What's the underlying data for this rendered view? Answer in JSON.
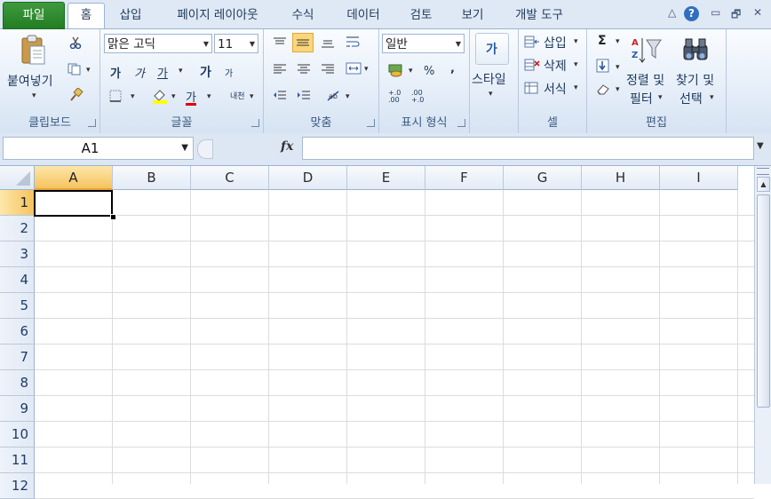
{
  "tabs": {
    "file": "파일",
    "home": "홈",
    "insert": "삽입",
    "page_layout": "페이지 레이아웃",
    "formulas": "수식",
    "data": "데이터",
    "review": "검토",
    "view": "보기",
    "developer": "개발 도구"
  },
  "window_controls": {
    "minimize_ribbon": "△",
    "help": "?",
    "minimize": "▭",
    "restore": "🗗",
    "close": "✕"
  },
  "clipboard": {
    "paste": "붙여넣기",
    "label": "클립보드"
  },
  "font": {
    "name": "맑은 고딕",
    "size": "11",
    "bold": "가",
    "italic": "가",
    "underline": "가",
    "grow": "가",
    "shrink": "가",
    "font_color_glyph": "가",
    "phonetic": "내천",
    "label": "글꼴"
  },
  "alignment": {
    "label": "맞춤"
  },
  "number": {
    "format": "일반",
    "percent": "%",
    "comma": ",",
    "inc_dec": "+.0 .00",
    "dec_dec": ".00 +.0",
    "label": "표시 형식"
  },
  "styles": {
    "button": "스타일",
    "glyph": "가"
  },
  "cells": {
    "insert": "삽입",
    "delete": "삭제",
    "format": "서식",
    "label": "셀"
  },
  "editing": {
    "sum": "Σ",
    "sort_filter_1": "정렬 및",
    "sort_filter_2": "필터",
    "find_select_1": "찾기 및",
    "find_select_2": "선택",
    "label": "편집"
  },
  "formula_bar": {
    "name_box": "A1",
    "fx": "fx",
    "value": ""
  },
  "sheet": {
    "columns": [
      "A",
      "B",
      "C",
      "D",
      "E",
      "F",
      "G",
      "H",
      "I"
    ],
    "rows": [
      "1",
      "2",
      "3",
      "4",
      "5",
      "6",
      "7",
      "8",
      "9",
      "10",
      "11",
      "12"
    ],
    "active_cell": "A1"
  },
  "colors": {
    "file_tab": "#2f8a2f",
    "selection_header": "#f6c35e",
    "accent": "#2f6fc0"
  }
}
